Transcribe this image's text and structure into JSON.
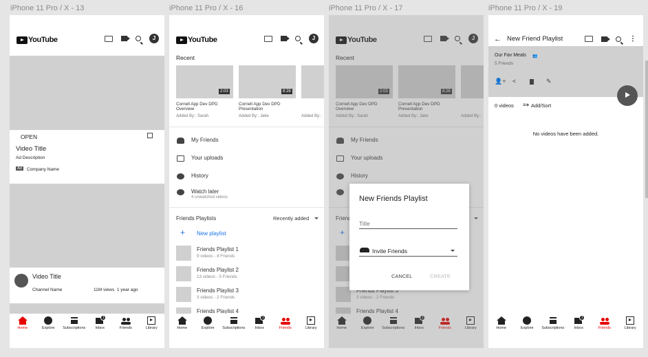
{
  "frames": [
    {
      "title": "iPhone 11 Pro / X - 13"
    },
    {
      "title": "iPhone 11 Pro / X - 16"
    },
    {
      "title": "iPhone 11 Pro / X - 17"
    },
    {
      "title": "iPhone 11 Pro / X - 19"
    }
  ],
  "app": {
    "logo_text": "YouTube",
    "avatar_letter": "J"
  },
  "nav": {
    "home": "Home",
    "explore": "Explore",
    "subscriptions": "Subscriptions",
    "inbox": "Inbox",
    "friends": "Friends",
    "library": "Library",
    "inbox_badge": "1"
  },
  "home": {
    "ad": {
      "open_label": "OPEN",
      "title": "Video Title",
      "description": "Ad Description",
      "ad_badge": "Ad",
      "company": "Company Name"
    },
    "video": {
      "title": "Video Title",
      "channel": "Channel Name",
      "meta": "11M views  1 year ago"
    }
  },
  "library": {
    "recent_heading": "Recent",
    "recent": [
      {
        "duration": "2:03",
        "title": "Cornell App Dev DPD Overview",
        "added_by": "Added By:: Sarah"
      },
      {
        "duration": "8:28",
        "title": "Cornell App Dev DPD Presentation",
        "added_by": "Added By:: Jake"
      },
      {
        "duration": "",
        "title": "",
        "added_by": "Added By::"
      }
    ],
    "menu": [
      {
        "icon": "friends-icon",
        "label": "My Friends",
        "sub": ""
      },
      {
        "icon": "play-square-icon",
        "label": "Your uploads",
        "sub": ""
      },
      {
        "icon": "history-icon",
        "label": "History",
        "sub": ""
      },
      {
        "icon": "clock-icon",
        "label": "Watch later",
        "sub": "4 unwatched videos"
      }
    ],
    "playlists_heading": "Friends Playlists",
    "sort_label": "Recently added",
    "new_playlist": "New playlist",
    "playlists": [
      {
        "name": "Friends Playlist 1",
        "meta": "9 videos - 4 Friends"
      },
      {
        "name": "Friends Playlist 2",
        "meta": "13 videos - 5 Friends"
      },
      {
        "name": "Friends Playlist 3",
        "meta": "3 videos - 2 Friends"
      },
      {
        "name": "Friends Playlist 4",
        "meta": ""
      }
    ]
  },
  "dialog": {
    "title": "New Friends Playlist",
    "title_placeholder": "Title",
    "invite_label": "Invite Friends",
    "cancel": "CANCEL",
    "create": "CREATE"
  },
  "playlist_page": {
    "header_title": "New Friend Playlist",
    "playlist_name": "Our Fav Meals",
    "friend_count": "5 Friends",
    "video_count": "0 videos",
    "add_sort": "Add/Sort",
    "empty_message": "No videos have been added."
  },
  "colors": {
    "accent": "#e60000",
    "link": "#1a73e8",
    "placeholder": "#d0d0d0"
  }
}
